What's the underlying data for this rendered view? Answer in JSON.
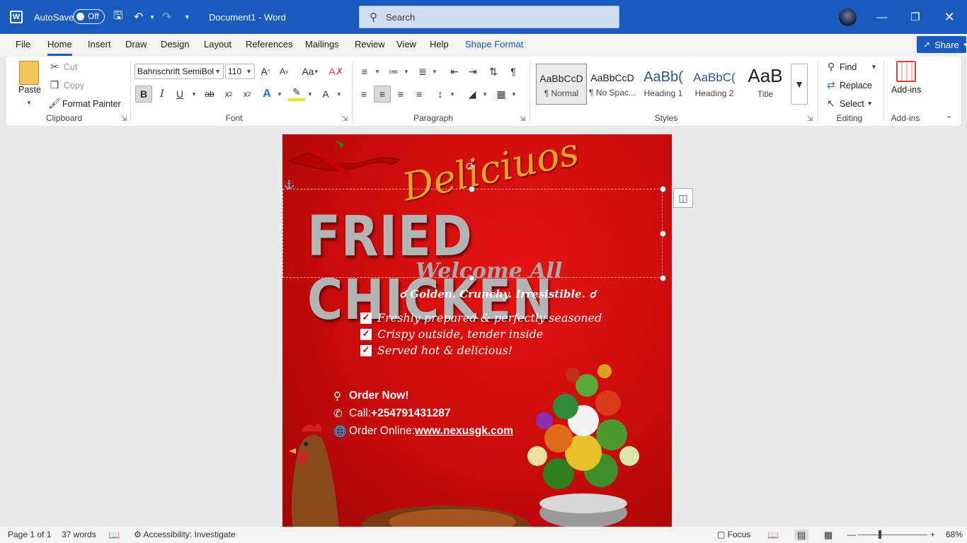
{
  "titlebar": {
    "autosave_label": "AutoSave",
    "autosave_state": "Off",
    "document_title": "Document1  -  Word",
    "search_placeholder": "Search"
  },
  "menu": {
    "tabs": [
      "File",
      "Home",
      "Insert",
      "Draw",
      "Design",
      "Layout",
      "References",
      "Mailings",
      "Review",
      "View",
      "Help",
      "Shape Format"
    ],
    "share_label": "Share"
  },
  "ribbon": {
    "clipboard": {
      "paste": "Paste",
      "cut": "Cut",
      "copy": "Copy",
      "format_painter": "Format Painter",
      "label": "Clipboard"
    },
    "font": {
      "family": "Bahnschrift SemiBol",
      "size": "110",
      "label": "Font"
    },
    "paragraph": {
      "label": "Paragraph"
    },
    "styles": {
      "label": "Styles",
      "items": [
        {
          "preview": "AaBbCcD",
          "name": "¶ Normal"
        },
        {
          "preview": "AaBbCcD",
          "name": "¶ No Spac..."
        },
        {
          "preview": "AaBb(",
          "name": "Heading 1"
        },
        {
          "preview": "AaBbC(",
          "name": "Heading 2"
        },
        {
          "preview": "AaB",
          "name": "Title"
        }
      ]
    },
    "editing": {
      "find": "Find",
      "replace": "Replace",
      "select": "Select",
      "label": "Editing"
    },
    "addins": {
      "button": "Add-ins",
      "label": "Add-ins"
    }
  },
  "flyer": {
    "script_title": "Deliciuos",
    "headline": "FRIED CHICKEN",
    "subheadline": "Welcome All",
    "tagline": "Golden. Crunchy. Irresistible.",
    "features": [
      "Freshly prepared & perfectly seasoned",
      "Crispy outside, tender inside",
      "Served hot & delicious!"
    ],
    "order_now": "Order Now!",
    "call_label": "Call: ",
    "phone": "+254791431287",
    "online_label": "Order Online: ",
    "website": "www.nexusgk.com"
  },
  "status": {
    "page": "Page 1 of 1",
    "words": "37 words",
    "accessibility": "Accessibility: Investigate",
    "focus": "Focus",
    "zoom": "68%"
  },
  "colors": {
    "word_blue": "#185abd",
    "flyer_red": "#d10d0d",
    "gold": "#e0a52a"
  }
}
